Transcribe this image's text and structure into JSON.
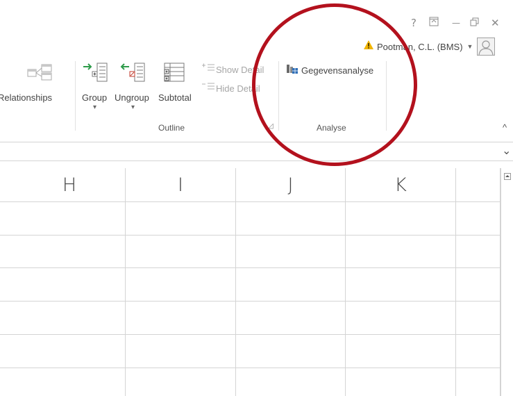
{
  "window": {
    "help_glyph": "?",
    "ribbon_display_glyph": "⊼",
    "minimize_glyph": "—",
    "restore_glyph": "▭",
    "close_glyph": "✕"
  },
  "account": {
    "warning_icon": "warning-icon",
    "user_name": "Pootman, C.L. (BMS)",
    "caret": "▼"
  },
  "ribbon": {
    "relationships_label": "Relationships",
    "outline": {
      "group_label": "Group",
      "ungroup_label": "Ungroup",
      "subtotal_label": "Subtotal",
      "show_detail_label": "Show Detail",
      "hide_detail_label": "Hide Detail",
      "group_name": "Outline",
      "dropdown_glyph": "▾",
      "launcher_glyph": "◿"
    },
    "analyse": {
      "gegevensanalyse_label": "Gegevensanalyse",
      "group_name": "Analyse"
    },
    "collapse_glyph": "^"
  },
  "formula_bar": {
    "expand_glyph": "⌄"
  },
  "sheet": {
    "columns": [
      "H",
      "I",
      "J",
      "K",
      ""
    ]
  },
  "colors": {
    "annotation_red": "#b3111d",
    "green_arrow": "#2e9b4a",
    "red_mark": "#c0392b",
    "warning_yellow": "#f0b400"
  }
}
